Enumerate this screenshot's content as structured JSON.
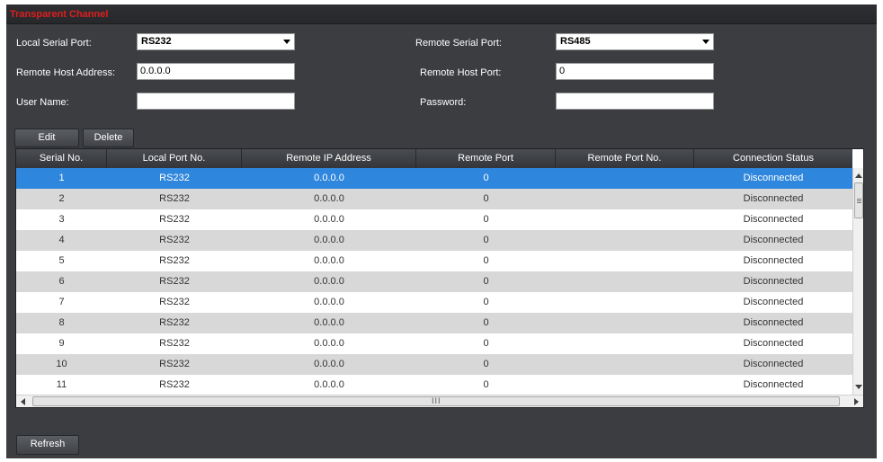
{
  "panel": {
    "title": "Transparent Channel"
  },
  "form": {
    "local_serial_port_label": "Local Serial Port:",
    "local_serial_port_value": "RS232",
    "remote_serial_port_label": "Remote Serial Port:",
    "remote_serial_port_value": "RS485",
    "remote_host_address_label": "Remote Host Address:",
    "remote_host_address_value": "0.0.0.0",
    "remote_host_port_label": "Remote Host Port:",
    "remote_host_port_value": "0",
    "user_name_label": "User Name:",
    "user_name_value": "",
    "password_label": "Password:",
    "password_value": ""
  },
  "toolbar": {
    "edit_label": "Edit",
    "delete_label": "Delete"
  },
  "table": {
    "columns": [
      "Serial No.",
      "Local Port No.",
      "Remote IP Address",
      "Remote Port",
      "Remote Port No.",
      "Connection Status"
    ],
    "selected_row": 0,
    "rows": [
      [
        "1",
        "RS232",
        "0.0.0.0",
        "0",
        "",
        "Disconnected"
      ],
      [
        "2",
        "RS232",
        "0.0.0.0",
        "0",
        "",
        "Disconnected"
      ],
      [
        "3",
        "RS232",
        "0.0.0.0",
        "0",
        "",
        "Disconnected"
      ],
      [
        "4",
        "RS232",
        "0.0.0.0",
        "0",
        "",
        "Disconnected"
      ],
      [
        "5",
        "RS232",
        "0.0.0.0",
        "0",
        "",
        "Disconnected"
      ],
      [
        "6",
        "RS232",
        "0.0.0.0",
        "0",
        "",
        "Disconnected"
      ],
      [
        "7",
        "RS232",
        "0.0.0.0",
        "0",
        "",
        "Disconnected"
      ],
      [
        "8",
        "RS232",
        "0.0.0.0",
        "0",
        "",
        "Disconnected"
      ],
      [
        "9",
        "RS232",
        "0.0.0.0",
        "0",
        "",
        "Disconnected"
      ],
      [
        "10",
        "RS232",
        "0.0.0.0",
        "0",
        "",
        "Disconnected"
      ],
      [
        "11",
        "RS232",
        "0.0.0.0",
        "0",
        "",
        "Disconnected"
      ]
    ]
  },
  "footer": {
    "refresh_label": "Refresh"
  },
  "colors": {
    "title_red": "#e01e1e",
    "panel_bg": "#3b3d41",
    "selected_row": "#2f87dd",
    "alt_row": "#d8d8d8"
  },
  "icons": {
    "dropdown": "chevron-down-icon",
    "scroll_up": "arrow-up-icon",
    "scroll_down": "arrow-down-icon",
    "scroll_left": "arrow-left-icon",
    "scroll_right": "arrow-right-icon"
  }
}
